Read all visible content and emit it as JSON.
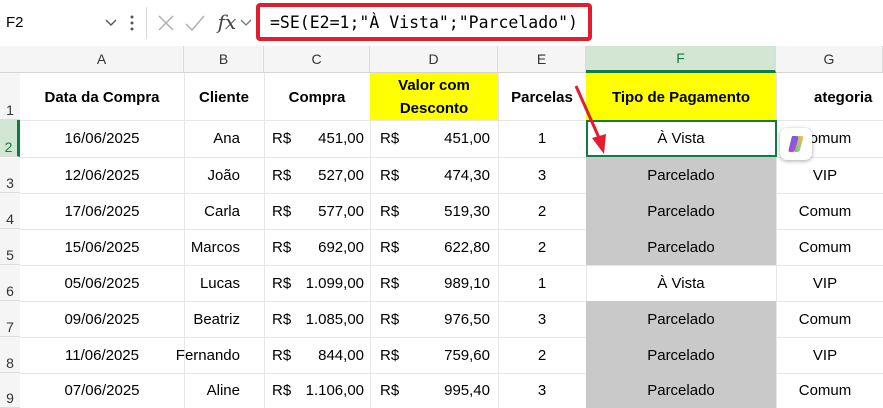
{
  "formula_bar": {
    "name_box": "F2",
    "fx_label": "fx",
    "formula": "=SE(E2=1;\"À Vista\";\"Parcelado\")"
  },
  "columns": [
    "A",
    "B",
    "C",
    "D",
    "E",
    "F",
    "G"
  ],
  "rows": [
    "1",
    "2",
    "3",
    "4",
    "5",
    "6",
    "7",
    "8",
    "9"
  ],
  "selected_cell": {
    "column": "F",
    "row": "2"
  },
  "headers": {
    "data_compra": "Data da Compra",
    "cliente": "Cliente",
    "compra": "Compra",
    "valor_desconto_1": "Valor com",
    "valor_desconto_2": "Desconto",
    "parcelas": "Parcelas",
    "tipo_pagamento": "Tipo de Pagamento",
    "categoria": "ategoria"
  },
  "currency": "R$",
  "table": [
    {
      "data": "16/06/2025",
      "cliente": "Ana",
      "compra": "451,00",
      "desconto": "451,00",
      "parcelas": "1",
      "tipo": "À Vista",
      "categoria": "Comum"
    },
    {
      "data": "12/06/2025",
      "cliente": "João",
      "compra": "527,00",
      "desconto": "474,30",
      "parcelas": "3",
      "tipo": "Parcelado",
      "categoria": "VIP"
    },
    {
      "data": "17/06/2025",
      "cliente": "Carla",
      "compra": "577,00",
      "desconto": "519,30",
      "parcelas": "2",
      "tipo": "Parcelado",
      "categoria": "Comum"
    },
    {
      "data": "15/06/2025",
      "cliente": "Marcos",
      "compra": "692,00",
      "desconto": "622,80",
      "parcelas": "2",
      "tipo": "Parcelado",
      "categoria": "Comum"
    },
    {
      "data": "05/06/2025",
      "cliente": "Lucas",
      "compra": "1.099,00",
      "desconto": "989,10",
      "parcelas": "1",
      "tipo": "À Vista",
      "categoria": "VIP"
    },
    {
      "data": "09/06/2025",
      "cliente": "Beatriz",
      "compra": "1.085,00",
      "desconto": "976,50",
      "parcelas": "3",
      "tipo": "Parcelado",
      "categoria": "Comum"
    },
    {
      "data": "11/06/2025",
      "cliente": "Fernando",
      "compra": "844,00",
      "desconto": "759,60",
      "parcelas": "2",
      "tipo": "Parcelado",
      "categoria": "VIP"
    },
    {
      "data": "07/06/2025",
      "cliente": "Aline",
      "compra": "1.106,00",
      "desconto": "995,40",
      "parcelas": "3",
      "tipo": "Parcelado",
      "categoria": "Comum"
    }
  ],
  "colors": {
    "header_highlight": "#ffff00",
    "parcelado_fill": "#c9c9c9",
    "selection_green": "#107c41",
    "annotation_red": "#e21d2e"
  },
  "icons": [
    "chevron-down-icon",
    "more-vertical-icon",
    "cancel-x-icon",
    "enter-check-icon",
    "copilot-icon",
    "annotation-arrow-icon"
  ]
}
